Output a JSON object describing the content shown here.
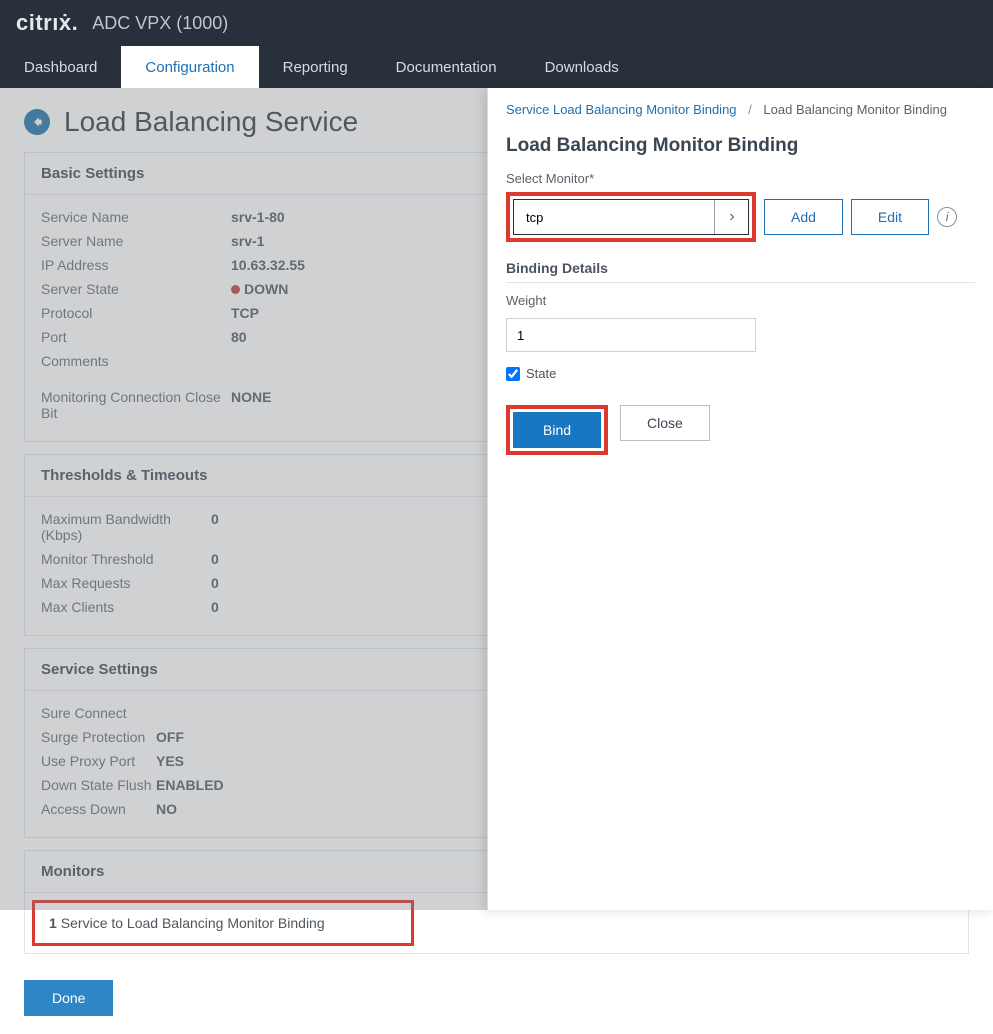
{
  "brand": "citrıẋ.",
  "product": "ADC VPX (1000)",
  "tabs": {
    "dashboard": "Dashboard",
    "configuration": "Configuration",
    "reporting": "Reporting",
    "documentation": "Documentation",
    "downloads": "Downloads"
  },
  "page": {
    "title": "Load Balancing Service",
    "sections": {
      "basic": {
        "head": "Basic Settings",
        "service_name_k": "Service Name",
        "service_name_v": "srv-1-80",
        "server_name_k": "Server Name",
        "server_name_v": "srv-1",
        "ip_k": "IP Address",
        "ip_v": "10.63.32.55",
        "state_k": "Server State",
        "state_v": "DOWN",
        "proto_k": "Protocol",
        "proto_v": "TCP",
        "port_k": "Port",
        "port_v": "80",
        "comments_k": "Comments",
        "comments_v": "",
        "mccb_k": "Monitoring Connection Close Bit",
        "mccb_v": "NONE"
      },
      "thr": {
        "head": "Thresholds & Timeouts",
        "bw_k": "Maximum Bandwidth (Kbps)",
        "bw_v": "0",
        "mt_k": "Monitor Threshold",
        "mt_v": "0",
        "mr_k": "Max Requests",
        "mr_v": "0",
        "mc_k": "Max Clients",
        "mc_v": "0"
      },
      "svc": {
        "head": "Service Settings",
        "sc_k": "Sure Connect",
        "sc_v": "",
        "sp_k": "Surge Protection",
        "sp_v": "OFF",
        "upp_k": "Use Proxy Port",
        "upp_v": "YES",
        "dsf_k": "Down State Flush",
        "dsf_v": "ENABLED",
        "ad_k": "Access Down",
        "ad_v": "NO"
      },
      "mon": {
        "head": "Monitors",
        "count": "1",
        "link": "Service to Load Balancing Monitor Binding"
      }
    },
    "done": "Done"
  },
  "panel": {
    "bread_link": "Service Load Balancing Monitor Binding",
    "bread_sep": "/",
    "bread_cur": "Load Balancing Monitor Binding",
    "title": "Load Balancing Monitor Binding",
    "select_label": "Select Monitor*",
    "select_value": "tcp",
    "add": "Add",
    "edit": "Edit",
    "info": "i",
    "binding_head": "Binding Details",
    "weight_label": "Weight",
    "weight_value": "1",
    "state_label": "State",
    "bind": "Bind",
    "close": "Close"
  }
}
